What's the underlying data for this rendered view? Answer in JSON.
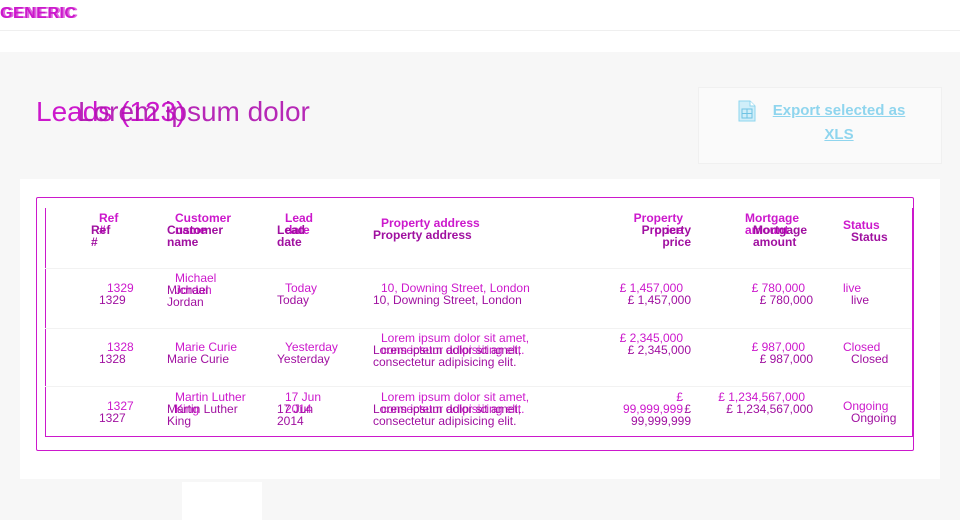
{
  "brand": {
    "name": "GENERIC",
    "ghost": "GENERIC"
  },
  "page": {
    "title": "Leads (123)",
    "title_overlay": "Lorem ipsum dolor",
    "export_label": "Export selected as XLS"
  },
  "table": {
    "headers": {
      "ref": "Ref #",
      "customer": "Customer name",
      "lead_date": "Lead date",
      "address": "Property address",
      "price": "Property price",
      "mortgage": "Mortgage amount",
      "status": "Status"
    },
    "rows": [
      {
        "ref": "1329",
        "customer": "Michael Jordan",
        "date": "Today",
        "address": "10, Downing Street, London",
        "price": "£ 1,457,000",
        "mortgage": "£ 780,000",
        "status": "live"
      },
      {
        "ref": "1328",
        "customer": "Marie Curie",
        "date": "Yesterday",
        "address": "Lorem ipsum dolor sit amet, consectetur adipisicing elit.",
        "price": "£ 2,345,000",
        "mortgage": "£ 987,000",
        "status": "Closed"
      },
      {
        "ref": "1327",
        "customer": "Martin Luther King",
        "date": "17 Jun 2014",
        "address": "Lorem ipsum dolor sit amet, consectetur adipisicing elit.",
        "price": "£ 99,999,999",
        "mortgage": "£ 1,234,567,000",
        "status": "Ongoing"
      }
    ]
  },
  "colors": {
    "accent": "#cc18cc",
    "link": "#8fd5ee"
  },
  "icons": {
    "export": "spreadsheet-file-icon"
  }
}
